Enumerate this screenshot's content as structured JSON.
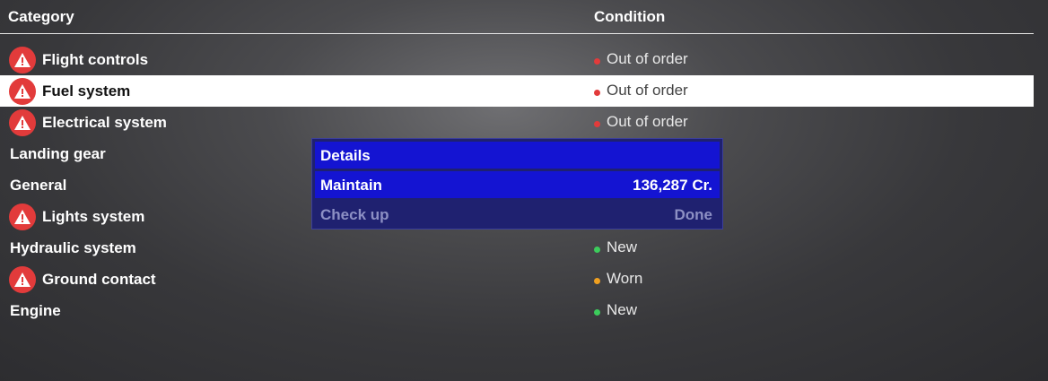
{
  "table": {
    "header": {
      "category": "Category",
      "condition": "Condition"
    },
    "rows": [
      {
        "name": "Flight controls",
        "status": "Out of order",
        "status_color": "#e23b3b",
        "warning": true,
        "selected": false
      },
      {
        "name": "Fuel system",
        "status": "Out of order",
        "status_color": "#e23b3b",
        "warning": true,
        "selected": true
      },
      {
        "name": "Electrical system",
        "status": "Out of order",
        "status_color": "#e23b3b",
        "warning": true,
        "selected": false
      },
      {
        "name": "Landing gear",
        "status": "",
        "status_color": "",
        "warning": false,
        "selected": false
      },
      {
        "name": "General",
        "status": "",
        "status_color": "",
        "warning": false,
        "selected": false
      },
      {
        "name": "Lights system",
        "status": "",
        "status_color": "",
        "warning": true,
        "selected": false
      },
      {
        "name": "Hydraulic system",
        "status": "New",
        "status_color": "#3ccc5c",
        "warning": false,
        "selected": false
      },
      {
        "name": "Ground contact",
        "status": "Worn",
        "status_color": "#f0a020",
        "warning": true,
        "selected": false
      },
      {
        "name": "Engine",
        "status": "New",
        "status_color": "#3ccc5c",
        "warning": false,
        "selected": false
      }
    ]
  },
  "context_menu": {
    "details": "Details",
    "maintain": {
      "label": "Maintain",
      "value": "136,287 Cr."
    },
    "check_up": {
      "label": "Check up",
      "value": "Done"
    }
  },
  "icons": {
    "warning": "warning-triangle-icon",
    "status": "status-dot-icon"
  }
}
